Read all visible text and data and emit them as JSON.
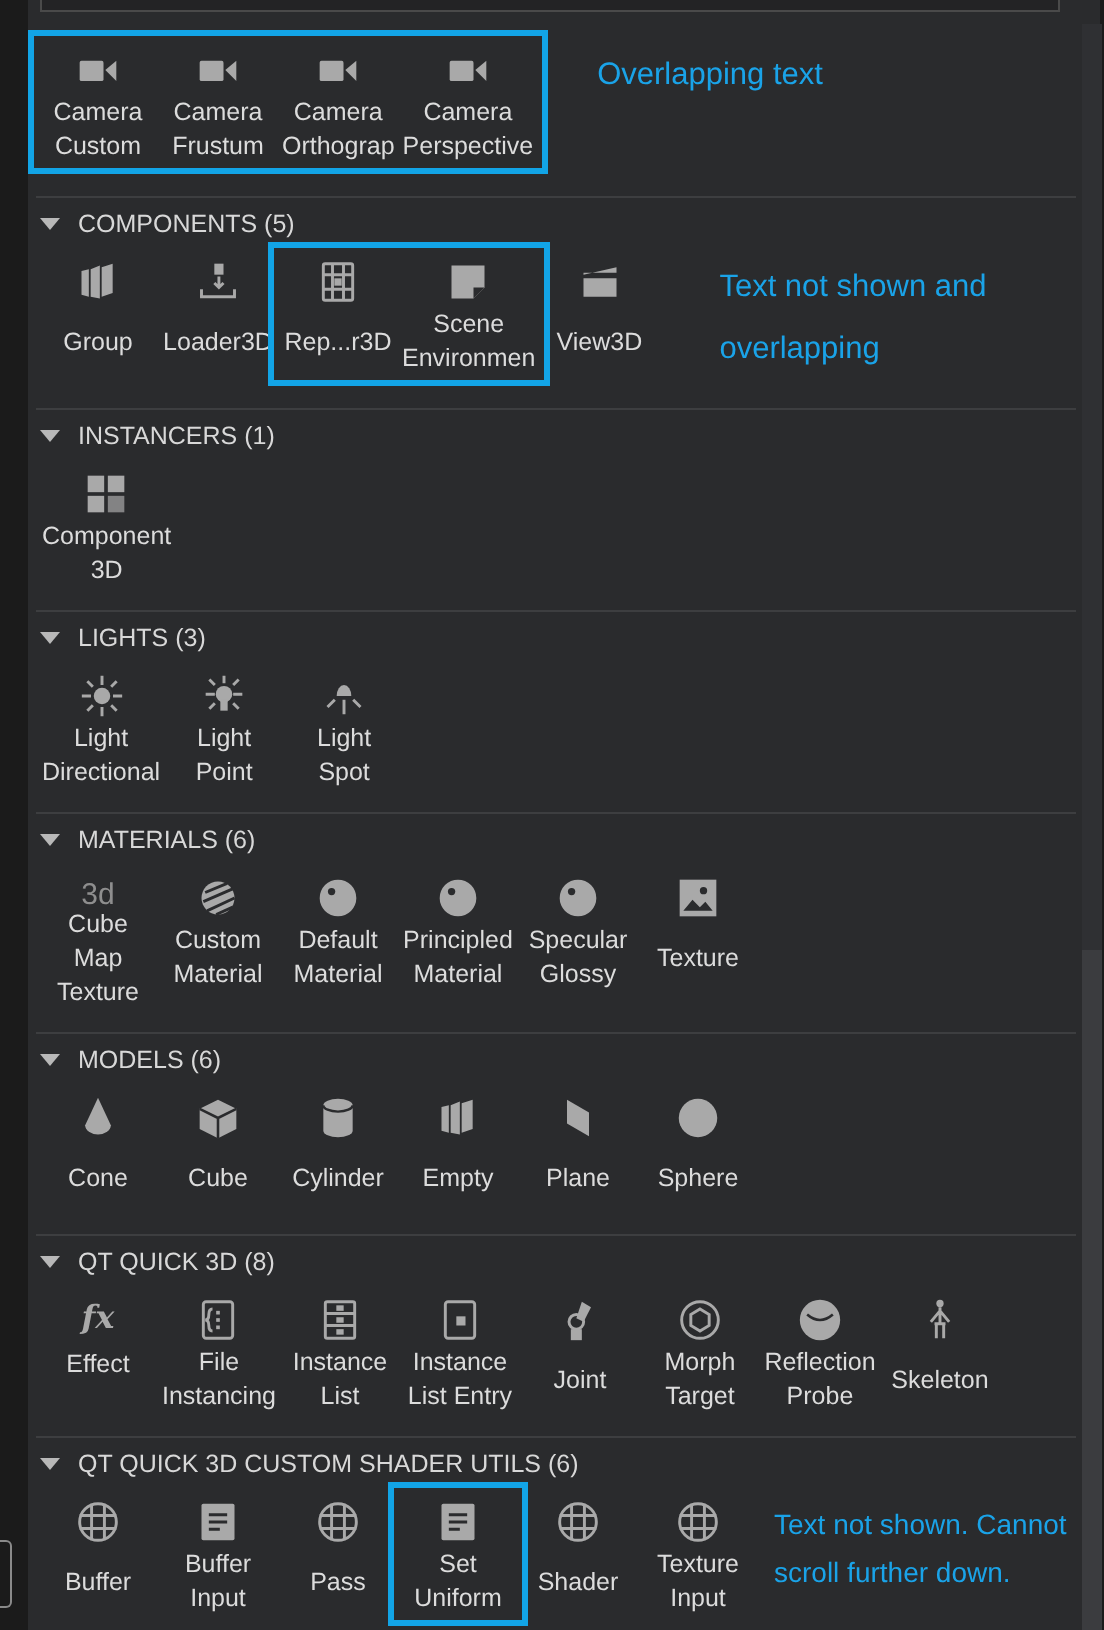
{
  "sections": [
    {
      "note": "Overlapping text",
      "items": [
        {
          "label": "Camera\nCustom",
          "framed": true
        },
        {
          "label": "Camera\nFrustum",
          "framed": true
        },
        {
          "label": "Camera\nOrthograp",
          "framed": true
        },
        {
          "label": "Camera\nPerspective",
          "framed": true
        }
      ]
    },
    {
      "title": "COMPONENTS (5)",
      "expanded": true,
      "note": "Text not shown and overlapping",
      "items": [
        {
          "label": "Group",
          "framed": false
        },
        {
          "label": "Loader3D",
          "framed": false
        },
        {
          "label": "Rep...r3D",
          "framed": true
        },
        {
          "label": "Scene\nEnvironmen",
          "framed": true
        },
        {
          "label": "View3D",
          "framed": false
        }
      ]
    },
    {
      "title": "INSTANCERS (1)",
      "expanded": true,
      "items": [
        {
          "label": "Component\n3D",
          "framed": false
        }
      ]
    },
    {
      "title": "LIGHTS (3)",
      "expanded": true,
      "items": [
        {
          "label": "Light\nDirectional",
          "framed": false
        },
        {
          "label": "Light\nPoint",
          "framed": false
        },
        {
          "label": "Light\nSpot",
          "framed": false
        }
      ]
    },
    {
      "title": "MATERIALS (6)",
      "expanded": true,
      "items": [
        {
          "label": "Cube\nMap\nTexture",
          "glyph": "3d",
          "framed": false
        },
        {
          "label": "Custom\nMaterial",
          "framed": false
        },
        {
          "label": "Default\nMaterial",
          "framed": false
        },
        {
          "label": "Principled\nMaterial",
          "framed": false
        },
        {
          "label": "Specular\nGlossy",
          "framed": false
        },
        {
          "label": "Texture",
          "framed": false
        }
      ]
    },
    {
      "title": "MODELS (6)",
      "expanded": true,
      "items": [
        {
          "label": "Cone",
          "framed": false
        },
        {
          "label": "Cube",
          "framed": false
        },
        {
          "label": "Cylinder",
          "framed": false
        },
        {
          "label": "Empty",
          "framed": false
        },
        {
          "label": "Plane",
          "framed": false
        },
        {
          "label": "Sphere",
          "framed": false
        }
      ]
    },
    {
      "title": "QT QUICK 3D (8)",
      "expanded": true,
      "items": [
        {
          "label": "Effect",
          "glyph": "fx",
          "framed": false
        },
        {
          "label": "File\nInstancing",
          "framed": false
        },
        {
          "label": "Instance\nList",
          "framed": false
        },
        {
          "label": "Instance\nList Entry",
          "framed": false
        },
        {
          "label": "Joint",
          "framed": false
        },
        {
          "label": "Morph\nTarget",
          "framed": false
        },
        {
          "label": "Reflection\nProbe",
          "framed": false
        },
        {
          "label": "Skeleton",
          "framed": false
        }
      ]
    },
    {
      "title": "QT QUICK 3D CUSTOM SHADER UTILS (6)",
      "expanded": true,
      "note": "Text not shown. Cannot scroll further down.",
      "items": [
        {
          "label": "Buffer",
          "framed": false
        },
        {
          "label": "Buffer\nInput",
          "framed": false
        },
        {
          "label": "Pass",
          "framed": false
        },
        {
          "label": "Set\nUniform",
          "framed": true
        },
        {
          "label": "Shader",
          "framed": false
        },
        {
          "label": "Texture\nInput",
          "framed": false
        }
      ]
    }
  ]
}
